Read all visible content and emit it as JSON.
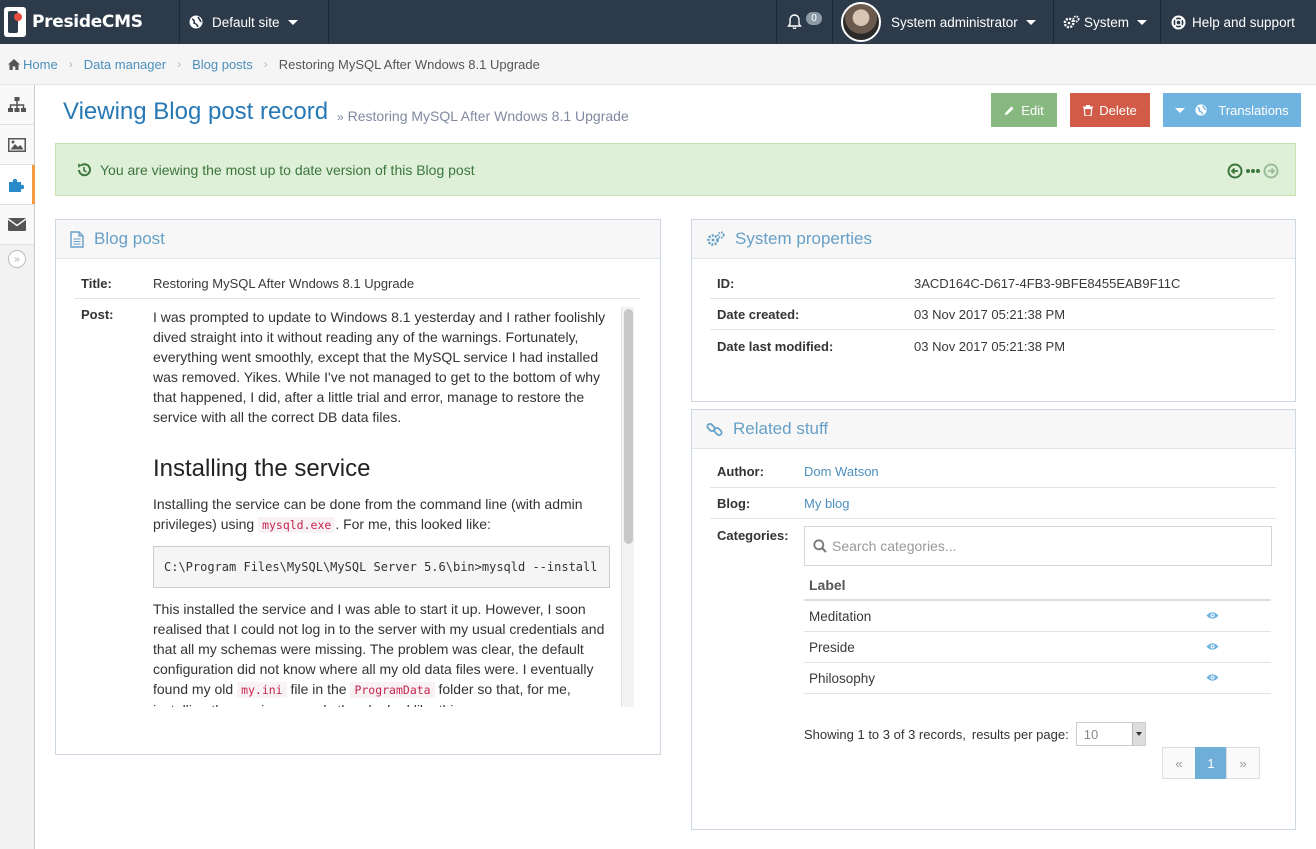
{
  "navbar": {
    "brand": "PresideCMS",
    "site_selector": "Default site",
    "notifications_count": "0",
    "user_name": "System administrator",
    "system_label": "System",
    "help_label": "Help and support"
  },
  "breadcrumb": {
    "home": "Home",
    "data_manager": "Data manager",
    "blog_posts": "Blog posts",
    "current": "Restoring MySQL After Wndows 8.1 Upgrade"
  },
  "page": {
    "title": "Viewing Blog post record",
    "subtitle": "Restoring MySQL After Wndows 8.1 Upgrade",
    "edit_label": "Edit",
    "delete_label": "Delete",
    "translations_label": "Translations"
  },
  "alert": {
    "message": "You are viewing the most up to date version of this Blog post"
  },
  "blog_post": {
    "header": "Blog post",
    "title_label": "Title:",
    "title_value": "Restoring MySQL After Wndows 8.1 Upgrade",
    "post_label": "Post:",
    "p1": "I was prompted to update to Windows 8.1 yesterday and I rather foolishly dived straight into it without reading any of the warnings. Fortunately, everything went smoothly, except that the MySQL service I had installed was removed. Yikes. While I've not managed to get to the bottom of why that happened, I did, after a little trial and error, manage to restore the service with all the correct DB data files.",
    "h2": "Installing the service",
    "p2_a": "Installing the service can be done from the command line (with admin privileges) using",
    "p2_code": "mysqld.exe",
    "p2_b": ". For me, this looked like:",
    "pre": "C:\\Program Files\\MySQL\\MySQL Server 5.6\\bin>mysqld --install",
    "p3_a": "This installed the service and I was able to start it up. However, I soon realised that I could not log in to the server with my usual credentials and that all my schemas were missing. The problem was clear, the default configuration did not know where all my old data files were. I eventually found my old",
    "p3_code1": "my.ini",
    "p3_b": "file in the",
    "p3_code2": "ProgramData",
    "p3_c": "folder so that, for me, installing the service properly then looked like this:"
  },
  "system_props": {
    "header": "System properties",
    "id_label": "ID:",
    "id_value": "3ACD164C-D617-4FB3-9BFE8455EAB9F11C",
    "created_label": "Date created:",
    "created_value": "03 Nov 2017 05:21:38 PM",
    "modified_label": "Date last modified:",
    "modified_value": "03 Nov 2017 05:21:38 PM"
  },
  "related": {
    "header": "Related stuff",
    "author_label": "Author:",
    "author_value": "Dom Watson",
    "blog_label": "Blog:",
    "blog_value": "My blog",
    "categories_label": "Categories:",
    "search_placeholder": "Search categories...",
    "column_label": "Label",
    "rows": [
      {
        "label": "Meditation"
      },
      {
        "label": "Preside"
      },
      {
        "label": "Philosophy"
      }
    ],
    "showing": "Showing 1 to 3 of 3 records,",
    "per_page_label": "results per page:",
    "per_page_value": "10",
    "page_prev": "«",
    "page_current": "1",
    "page_next": "»"
  },
  "colors": {
    "navbar": "#2c3a4a",
    "title": "#2679b5",
    "edit": "#87b87f",
    "delete": "#d15b47",
    "translations": "#6fb3e0",
    "alert_bg": "#dff0d8"
  }
}
